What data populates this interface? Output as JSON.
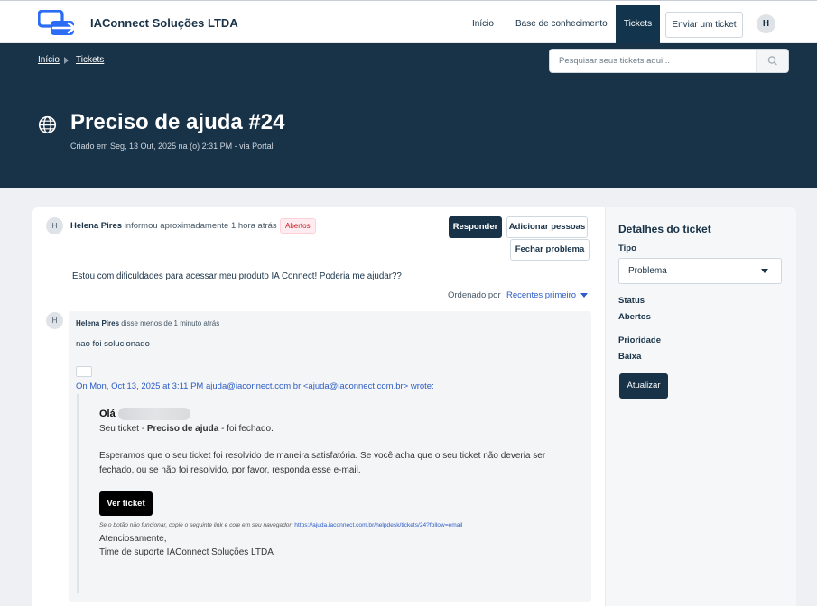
{
  "header": {
    "brand": "IAConnect Soluções LTDA",
    "nav": {
      "inicio": "Início",
      "base": "Base de conhecimento",
      "tickets": "Tickets",
      "enviar": "Enviar um ticket",
      "avatar": "H"
    }
  },
  "hero": {
    "breadcrumb": {
      "home": "Início",
      "tickets": "Tickets"
    },
    "search_placeholder": "Pesquisar seus tickets aqui...",
    "title": "Preciso de ajuda #24",
    "subtitle": "Criado em Seg, 13 Out, 2025 na (o) 2:31 PM - via Portal"
  },
  "ticket": {
    "avatar": "H",
    "author": "Helena Pires",
    "action": "informou aproximadamente 1 hora atrás",
    "status_badge": "Abertos",
    "buttons": {
      "responder": "Responder",
      "adicionar": "Adicionar pessoas",
      "fechar": "Fechar problema"
    },
    "message": "Estou com dificuldades para acessar meu produto IA Connect! Poderia me ajudar??",
    "sort_label": "Ordenado por",
    "sort_value": "Recentes primeiro"
  },
  "reply": {
    "avatar": "H",
    "author": "Helena Pires",
    "action": "disse menos de 1 minuto atrás",
    "text": "nao foi solucionado",
    "ellipsis": "...",
    "quote_prefix": "On Mon, Oct 13, 2025 at 3:11 PM",
    "quote_email": "ajuda@iaconnect.com.br",
    "quote_suffix": "<ajuda@iaconnect.com.br> wrote:",
    "email": {
      "greeting": "Olá",
      "line1_pre": "Seu ticket - ",
      "line1_bold": "Preciso de ajuda",
      "line1_post": " - foi fechado.",
      "line2": "Esperamos que o seu ticket foi resolvido de maneira satisfatória. Se você acha que o seu ticket não deveria ser",
      "line3": "fechado, ou se não foi resolvido, por favor, responda esse e-mail.",
      "button": "Ver ticket",
      "fallback_text": "Se o botão não funcionar, copie o seguinte link e cole em seu navegador:",
      "fallback_link": "https://ajuda.iaconnect.com.br/helpdesk/tickets/24?follow=email",
      "signoff": "Atenciosamente,",
      "team": "Time de suporte IAConnect Soluções LTDA"
    }
  },
  "sidebar": {
    "title": "Detalhes do ticket",
    "tipo_label": "Tipo",
    "tipo_value": "Problema",
    "status_label": "Status",
    "status_value": "Abertos",
    "prioridade_label": "Prioridade",
    "prioridade_value": "Baixa",
    "update_button": "Atualizar"
  },
  "colors": {
    "navy": "#183247",
    "link": "#2c5cc5",
    "logo_blue": "#2a6df4"
  }
}
